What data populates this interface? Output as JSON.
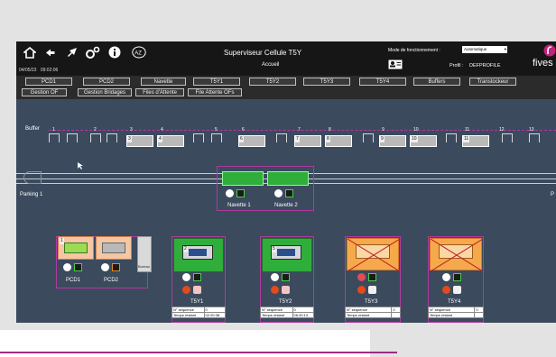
{
  "header": {
    "date": "04/05/23",
    "time": "09:02:06",
    "title": "Superviseur Cellule T5Y",
    "subtitle": "Accueil",
    "mode_label": "Mode de fonctionnement :",
    "mode_value": "Automatique",
    "profile_label": "Profil :",
    "profile_value": "DEFPROFILE",
    "brand": "fives",
    "colors": {
      "accent": "#c0237a",
      "topbar": "#161616",
      "canvas": "#3b4a5d"
    }
  },
  "nav": {
    "row1": [
      "PCD1",
      "PCD2",
      "Navette",
      "T5Y1",
      "T5Y2",
      "T5Y3",
      "T5Y4",
      "Buffers",
      "Transtockeur"
    ],
    "row2": [
      "Gestion OF",
      "Gestion Bridages",
      "Files d'Attente",
      "File Attente OFs"
    ]
  },
  "buffer": {
    "label": "Buffer",
    "numbers": [
      "1",
      "2",
      "3",
      "4",
      "5",
      "6",
      "7",
      "8",
      "9",
      "10",
      "11",
      "12",
      "13"
    ],
    "slot_tags": [
      "3",
      "4",
      "6",
      "7",
      "8",
      "9",
      "10",
      "11"
    ]
  },
  "parking": {
    "left": "Parking 1",
    "right": "P"
  },
  "navettes": [
    {
      "label": "Navette 1"
    },
    {
      "label": "Navette 2"
    }
  ],
  "pcd": [
    {
      "label": "PCD1",
      "tag": "1"
    },
    {
      "label": "PCD2",
      "tag": ""
    }
  ],
  "bureau": "Bureau",
  "stations": [
    {
      "label": "T5Y1",
      "tag": "2",
      "seq_label": "N° séquence",
      "seq_value": "0",
      "time_label": "Temps restant",
      "time_value": "02:20:38"
    },
    {
      "label": "T5Y2",
      "tag": "5",
      "seq_label": "N° séquence",
      "seq_value": "0",
      "time_label": "Temps restant",
      "time_value": "06:20:13"
    },
    {
      "label": "T5Y3",
      "tag": "",
      "seq_label": "N° séquence",
      "seq_value": "0",
      "time_label": "Temps restant",
      "time_value": ""
    },
    {
      "label": "T5Y4",
      "tag": "",
      "seq_label": "N° séquence",
      "seq_value": "0",
      "time_label": "Temps restant",
      "time_value": ""
    }
  ],
  "icons": [
    "home-icon",
    "back-arrow-icon",
    "rocket-icon",
    "settings-gears-icon",
    "info-icon",
    "translate-icon",
    "id-card-icon"
  ]
}
